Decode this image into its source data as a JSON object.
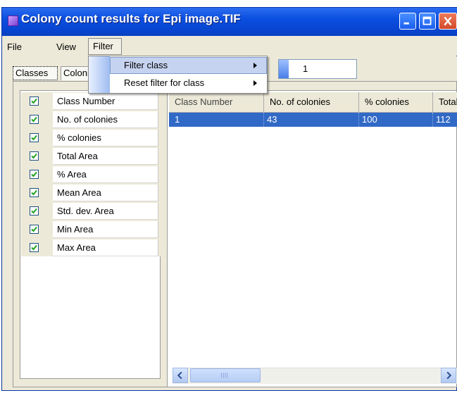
{
  "window": {
    "title": "Colony count results for Epi image.TIF",
    "icon": "app-icon"
  },
  "menubar": {
    "file": "File",
    "view": "View",
    "filter": "Filter"
  },
  "filter_menu": {
    "items": [
      {
        "label": "Filter class",
        "has_submenu": true,
        "highlighted": true
      },
      {
        "label": "Reset filter for class",
        "has_submenu": true,
        "highlighted": false
      }
    ]
  },
  "tabs": [
    {
      "label": "Classes",
      "active": true
    },
    {
      "label": "Colonies",
      "active": false
    }
  ],
  "filter_value": "1",
  "column_options": [
    {
      "label": "Class Number",
      "checked": true
    },
    {
      "label": "No. of colonies",
      "checked": true
    },
    {
      "label": "% colonies",
      "checked": true
    },
    {
      "label": "Total Area",
      "checked": true
    },
    {
      "label": "% Area",
      "checked": true
    },
    {
      "label": "Mean Area",
      "checked": true
    },
    {
      "label": "Std. dev. Area",
      "checked": true
    },
    {
      "label": "Min Area",
      "checked": true
    },
    {
      "label": "Max Area",
      "checked": true
    }
  ],
  "grid": {
    "columns": [
      "Class Number",
      "No. of colonies",
      "% colonies",
      "Total Area"
    ],
    "rows": [
      {
        "class_number": "1",
        "no_colonies": "43",
        "pct_colonies": "100",
        "total_area": "112"
      }
    ]
  },
  "colors": {
    "titlebar": "#0845d0",
    "selection": "#3169c6",
    "menu_highlight": "#c6d3f0"
  }
}
